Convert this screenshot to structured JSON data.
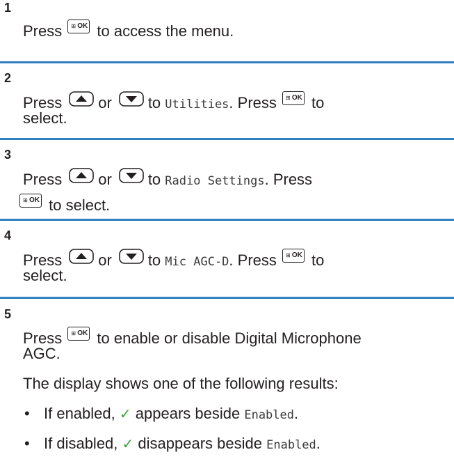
{
  "steps": [
    {
      "number": "1",
      "press": "Press",
      "key_ok_grid": "⊞",
      "key_ok_label": "OK",
      "text_after": "to access the menu."
    },
    {
      "number": "2",
      "press": "Press",
      "or": "or",
      "to": "to",
      "menu_item": "Utilities",
      "press2": ". Press",
      "to2": "to",
      "select": "select."
    },
    {
      "number": "3",
      "press": "Press",
      "or": "or",
      "to": "to",
      "menu_item": "Radio Settings",
      "press2": ". Press",
      "select": "to select."
    },
    {
      "number": "4",
      "press": "Press",
      "or": "or",
      "to": "to",
      "menu_item": "Mic AGC-D",
      "press2": ". Press",
      "to2": "to",
      "select": "select."
    },
    {
      "number": "5",
      "press": "Press",
      "text_after": "to enable or disable Digital Microphone",
      "text_cont": "AGC.",
      "result_intro": "The display shows one of the following results:",
      "bullets": [
        {
          "lead": "If enabled,",
          "mid": "appears beside",
          "status": "Enabled",
          "end": "."
        },
        {
          "lead": "If disabled,",
          "mid": "disappears beside",
          "status": "Enabled",
          "end": "."
        }
      ]
    }
  ],
  "icons": {
    "check": "✓",
    "bullet": "•"
  },
  "colors": {
    "separator": "#2f7fc1",
    "check": "#3aa335",
    "text": "#231f20"
  }
}
